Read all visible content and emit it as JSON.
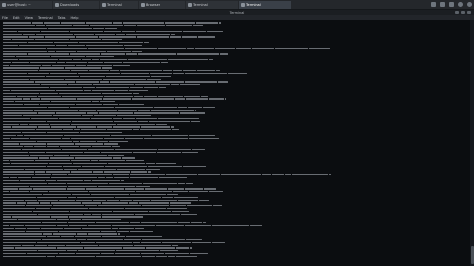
{
  "taskbar": {
    "tasks": [
      {
        "label": "user@host: ~",
        "active": false
      },
      {
        "label": "Downloads",
        "active": false
      },
      {
        "label": "Terminal",
        "active": false
      },
      {
        "label": "Browser",
        "active": false
      },
      {
        "label": "Terminal",
        "active": false
      },
      {
        "label": "Terminal",
        "active": true
      }
    ],
    "tray_icons": [
      "network-icon",
      "volume-icon",
      "battery-icon",
      "clock-icon",
      "power-icon"
    ]
  },
  "window": {
    "title": "Terminal"
  },
  "menubar": {
    "items": [
      "File",
      "Edit",
      "View",
      "Terminal",
      "Tabs",
      "Help"
    ]
  },
  "terminal": {
    "line_count": 84
  },
  "colors": {
    "desktop_bg": "#0c0f13",
    "terminal_bg": "#0b0d10",
    "terminal_fg": "#b7bcc2",
    "taskbar_bg": "#24272b",
    "active_task": "#3a4048"
  }
}
